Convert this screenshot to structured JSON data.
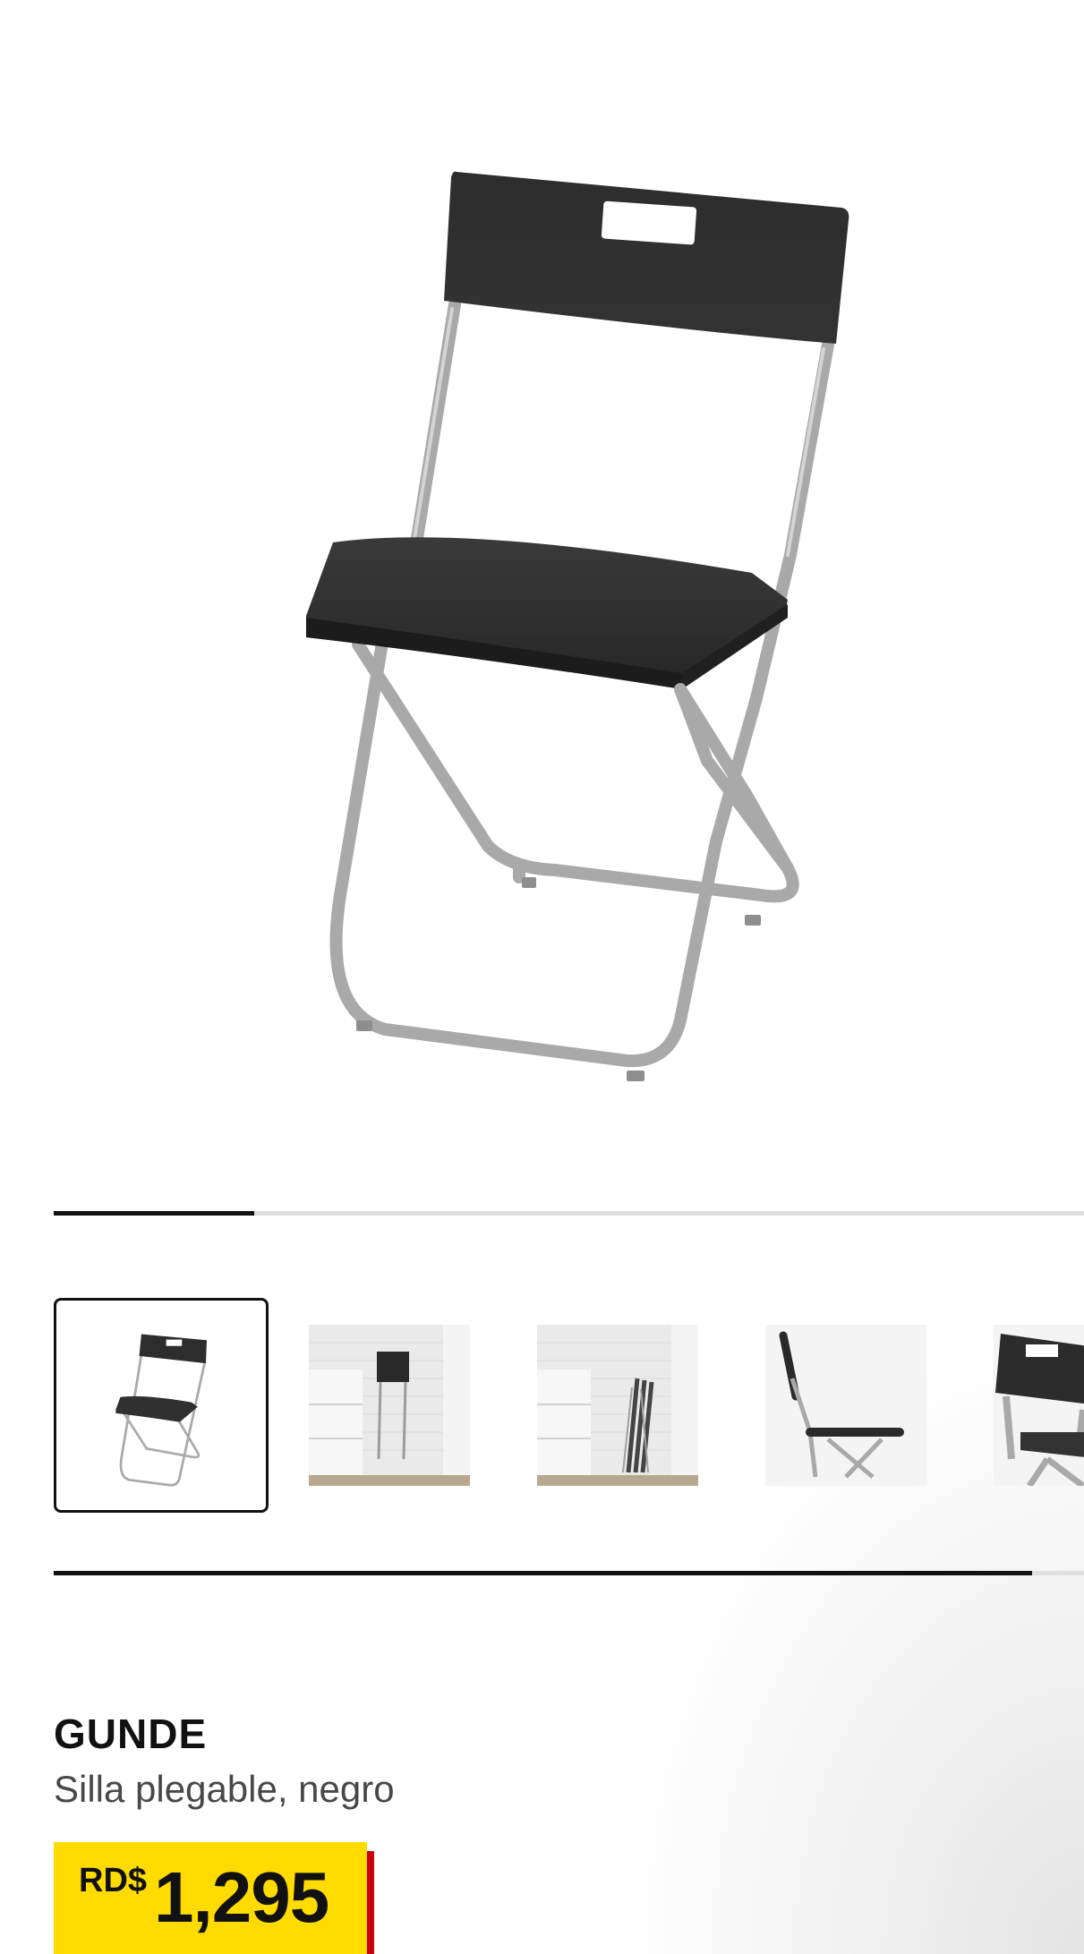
{
  "gallery": {
    "main_image_alt": "GUNDE silla plegable negro",
    "image_count": 5,
    "current_index": 1,
    "progress_fraction": 0.195
  },
  "thumbnails": {
    "items": [
      {
        "alt": "Silla plegable vista frontal",
        "selected": true
      },
      {
        "alt": "Silla plegada colgada en la pared",
        "selected": false
      },
      {
        "alt": "Sillas plegadas apiladas junto a la pared",
        "selected": false
      },
      {
        "alt": "Silla vista lateral",
        "selected": false
      },
      {
        "alt": "Detalle del respaldo",
        "selected": false
      }
    ],
    "scroll_fraction": 0.95
  },
  "product": {
    "name": "GUNDE",
    "description": "Silla plegable, negro",
    "price_currency": "RD$",
    "price_amount": "1,295"
  },
  "colors": {
    "price_background": "#ffdb00",
    "price_accent": "#cc0008",
    "text_primary": "#111111",
    "text_secondary": "#484848",
    "chair_black": "#2b2b2b",
    "frame_silver": "#b3b3b3"
  }
}
